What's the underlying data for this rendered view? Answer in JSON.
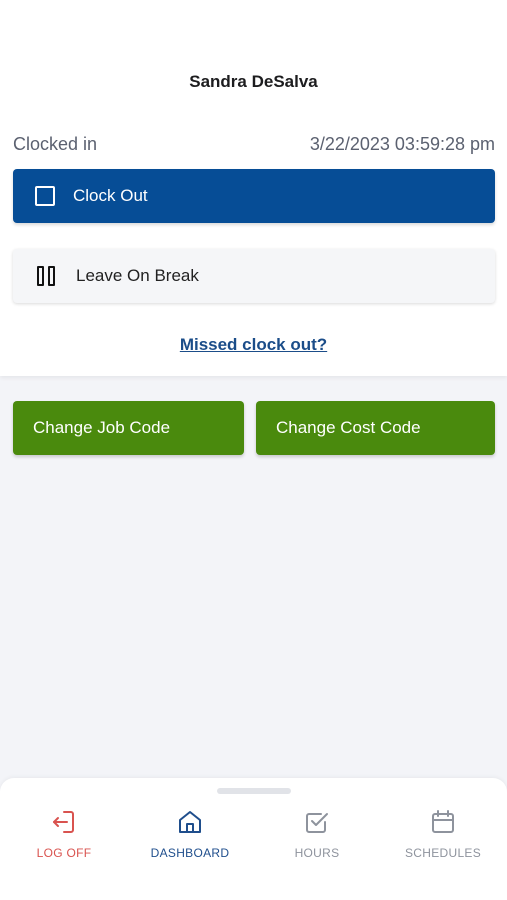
{
  "header": {
    "user_name": "Sandra DeSalva"
  },
  "status": {
    "label": "Clocked in",
    "timestamp": "3/22/2023 03:59:28 pm"
  },
  "actions": {
    "clock_out_label": "Clock Out",
    "break_label": "Leave On Break",
    "missed_link": "Missed clock out?",
    "change_job_label": "Change Job Code",
    "change_cost_label": "Change Cost Code"
  },
  "nav": {
    "items": [
      {
        "label": "LOG OFF",
        "icon": "log-off-icon",
        "color": "#d9534f"
      },
      {
        "label": "DASHBOARD",
        "icon": "home-icon",
        "color": "#1f4e8c",
        "active": true
      },
      {
        "label": "HOURS",
        "icon": "checkbox-icon",
        "color": "#8e939d"
      },
      {
        "label": "SCHEDULES",
        "icon": "calendar-icon",
        "color": "#8e939d"
      }
    ]
  },
  "colors": {
    "primary_blue": "#064d96",
    "green": "#4a8a0d",
    "background": "#f3f4f8",
    "danger": "#d9534f"
  }
}
